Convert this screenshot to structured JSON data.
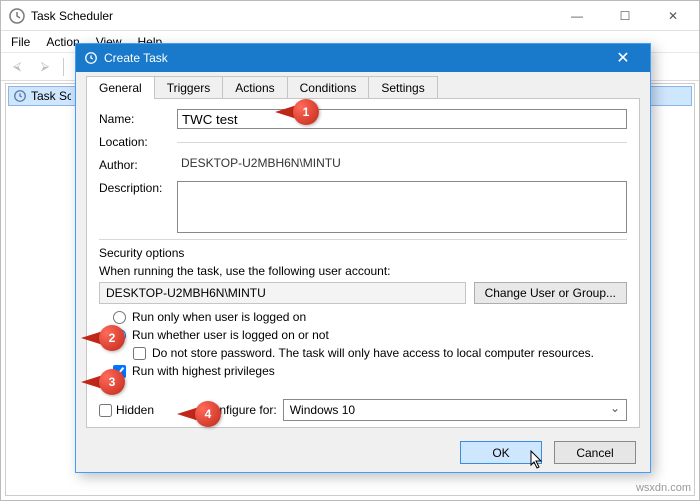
{
  "app": {
    "title": "Task Scheduler",
    "menu": [
      "File",
      "Action",
      "View",
      "Help"
    ],
    "tree_root": "Task Scheduler"
  },
  "dialog": {
    "title": "Create Task",
    "tabs": [
      "General",
      "Triggers",
      "Actions",
      "Conditions",
      "Settings"
    ],
    "name_label": "Name:",
    "name_value": "TWC test",
    "location_label": "Location:",
    "location_value": "",
    "author_label": "Author:",
    "author_value": "DESKTOP-U2MBH6N\\MINTU",
    "description_label": "Description:",
    "description_value": "",
    "security_title": "Security options",
    "security_prompt": "When running the task, use the following user account:",
    "security_user": "DESKTOP-U2MBH6N\\MINTU",
    "change_user_btn": "Change User or Group...",
    "radio_logged_on": "Run only when user is logged on",
    "radio_whether": "Run whether user is logged on or not",
    "radio_selected": "whether",
    "nostore_label": "Do not store password.  The task will only have access to local computer resources.",
    "nostore_checked": false,
    "highest_label": "Run with highest privileges",
    "highest_checked": true,
    "hidden_label": "Hidden",
    "hidden_checked": false,
    "configure_label": "Configure for:",
    "configure_value": "Windows 10",
    "ok_label": "OK",
    "cancel_label": "Cancel"
  },
  "callouts": [
    "1",
    "2",
    "3",
    "4"
  ],
  "watermark": "wsxdn.com"
}
